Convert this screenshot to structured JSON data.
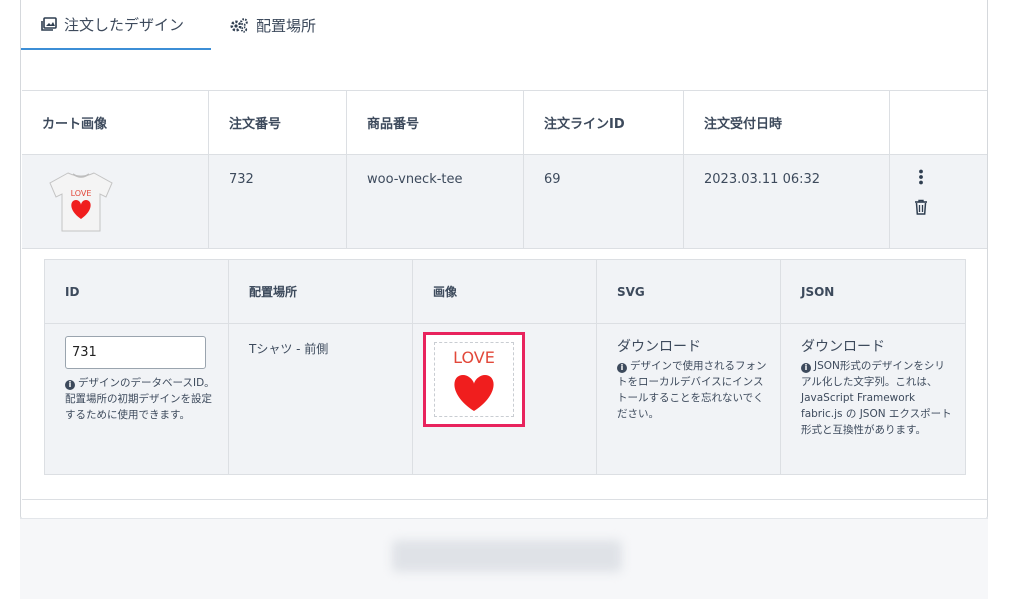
{
  "tabs": [
    {
      "label": "注文したデザイン",
      "icon": "images-icon"
    },
    {
      "label": "配置場所",
      "icon": "gears-icon"
    }
  ],
  "orders": {
    "headers": [
      "カート画像",
      "注文番号",
      "商品番号",
      "注文ラインID",
      "注文受付日時"
    ],
    "row": {
      "order_number": "732",
      "product_number": "woo-vneck-tee",
      "line_id": "69",
      "received_at": "2023.03.11 06:32",
      "image_text": "LOVE"
    }
  },
  "design": {
    "headers": [
      "ID",
      "配置場所",
      "画像",
      "SVG",
      "JSON"
    ],
    "id_value": "731",
    "id_help": "デザインのデータベースID。配置場所の初期デザインを設定するために使用できます。",
    "placement": "Tシャツ - 前側",
    "image_text": "LOVE",
    "svg_link": "ダウンロード",
    "svg_help": "デザインで使用されるフォントをローカルデバイスにインストールすることを忘れないでください。",
    "json_link": "ダウンロード",
    "json_help": "JSON形式のデザインをシリアル化した文字列。これは、JavaScript Framework fabric.js の JSON エクスポート形式と互換性があります。"
  },
  "colors": {
    "accent": "#3c8ed6",
    "highlight": "#e8235d",
    "heart": "#f01e1e"
  }
}
